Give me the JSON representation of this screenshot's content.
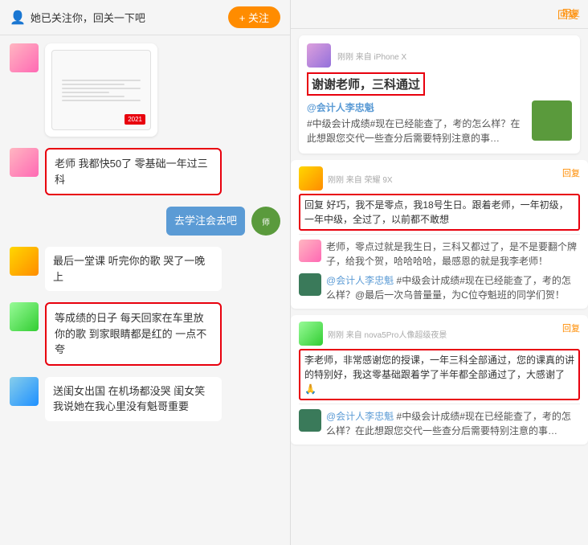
{
  "left": {
    "top_notice": "她已关注你，回关一下吧",
    "follow_btn": "+ 关注",
    "messages": [
      {
        "id": "msg1",
        "type": "doc",
        "side": "left"
      },
      {
        "id": "msg2",
        "type": "text",
        "side": "left",
        "text": "老师 我都快50了 零基础一年过三科",
        "highlighted": true
      },
      {
        "id": "msg3",
        "type": "text",
        "side": "right",
        "text": "去学注会去吧"
      },
      {
        "id": "msg4",
        "type": "text",
        "side": "left",
        "text": "最后一堂课 听完你的歌 哭了一晚上"
      },
      {
        "id": "msg5",
        "type": "text",
        "side": "left",
        "text": "等成绩的日子 每天回家在车里放你的歌 到家眼睛都是红的 一点不夸",
        "highlighted": true
      },
      {
        "id": "msg6",
        "type": "text",
        "side": "left",
        "text": "送闺女出国 在机场都没哭 闺女笑我说她在我心里没有魁哥重要"
      }
    ]
  },
  "right": {
    "reply_btn": "回复",
    "posts": [
      {
        "id": "post1",
        "device": "刚刚  来自 iPhone X",
        "title": "谢谢老师，三科通过",
        "body_name": "@会计人李忠魁",
        "body_text": "#中级会计成绩#现在已经能查了，考的怎么样？在此想跟您交代一些查分后需要特别注意的事…",
        "has_thumb": true,
        "reply_label": "回复"
      },
      {
        "id": "post2",
        "device": "刚刚  来自 荣耀 9X",
        "comment_text": "回复         好巧，我不是零点，我18号生日。跟着老师，一年初级，一年中级，全过了，以前都不敢想",
        "highlighted": true,
        "reply_label": "回复",
        "sub": {
          "name": "",
          "text": "老师，零点过就是我生日，三科又都过了，是不是要翻个牌子，给我个贺，哈哈哈哈，最感恩的就是我李老师！"
        },
        "sub2": {
          "name": "@会计人李忠魁",
          "text": "#中级会计成绩#现在已经能查了，考的怎么样？@最后一次乌普量量，为C位夺魁班的同学们贺！"
        }
      },
      {
        "id": "post3",
        "device": "刚刚  来自 nova5Pro人像超级夜景",
        "comment_text": "李老师，非常感谢您的授课，一年三科全部通过，您的课真的讲的特别好，我这零基础跟着学了半年都全部通过了，大感谢了🙏",
        "highlighted": true,
        "reply_label": "回复",
        "sub": {
          "name": "@会计人李忠魁",
          "text": "#中级会计成绩#现在已经能查了，考的怎么样？在此想跟您交代一些查分后需要特别注意的事…"
        }
      }
    ]
  }
}
